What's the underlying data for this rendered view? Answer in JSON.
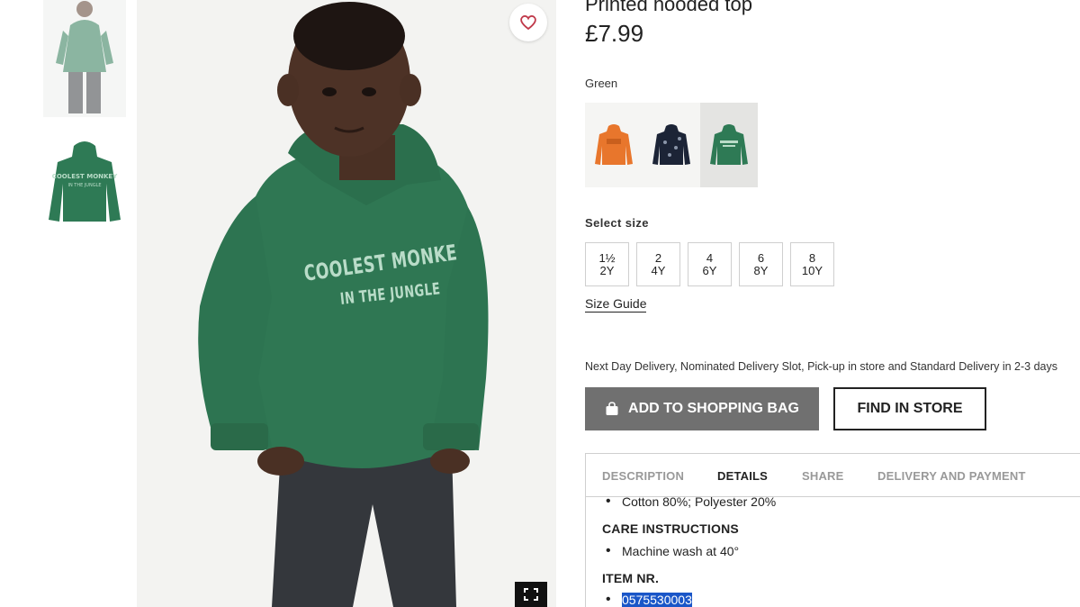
{
  "product": {
    "title": "Printed hooded top",
    "price": "£7.99",
    "color_label": "Green",
    "hoodie_print_line1": "COOLEST MONKE",
    "hoodie_print_line2": "IN THE JUNGLE",
    "colors": [
      {
        "name": "orange",
        "hex": "#e8762c"
      },
      {
        "name": "navy",
        "hex": "#1c2436"
      },
      {
        "name": "green",
        "hex": "#2e7a55",
        "selected": true
      }
    ]
  },
  "sizes": {
    "label": "Select size",
    "options": [
      {
        "top": "1½",
        "bottom": "2Y"
      },
      {
        "top": "2",
        "bottom": "4Y"
      },
      {
        "top": "4",
        "bottom": "6Y"
      },
      {
        "top": "6",
        "bottom": "8Y"
      },
      {
        "top": "8",
        "bottom": "10Y"
      }
    ],
    "guide_label": "Size Guide"
  },
  "delivery_text": "Next Day Delivery, Nominated Delivery Slot, Pick-up in store and Standard Delivery in 2-3 days",
  "actions": {
    "add_to_bag": "ADD TO SHOPPING BAG",
    "find_in_store": "FIND IN STORE"
  },
  "tabs": [
    {
      "label": "DESCRIPTION"
    },
    {
      "label": "DETAILS",
      "active": true
    },
    {
      "label": "SHARE"
    },
    {
      "label": "DELIVERY AND PAYMENT"
    }
  ],
  "details": {
    "composition": "Cotton 80%; Polyester 20%",
    "care_heading": "CARE INSTRUCTIONS",
    "care_item": "Machine wash at 40°",
    "item_heading": "ITEM NR.",
    "item_number": "0575530003"
  },
  "icons": {
    "favorite": "heart-icon",
    "zoom": "fullscreen-icon",
    "bag": "shopping-bag-icon"
  },
  "colors_ui": {
    "hoodie_green": "#2e7a55",
    "button_gray": "#707070",
    "selection_blue": "#1a56c8"
  }
}
